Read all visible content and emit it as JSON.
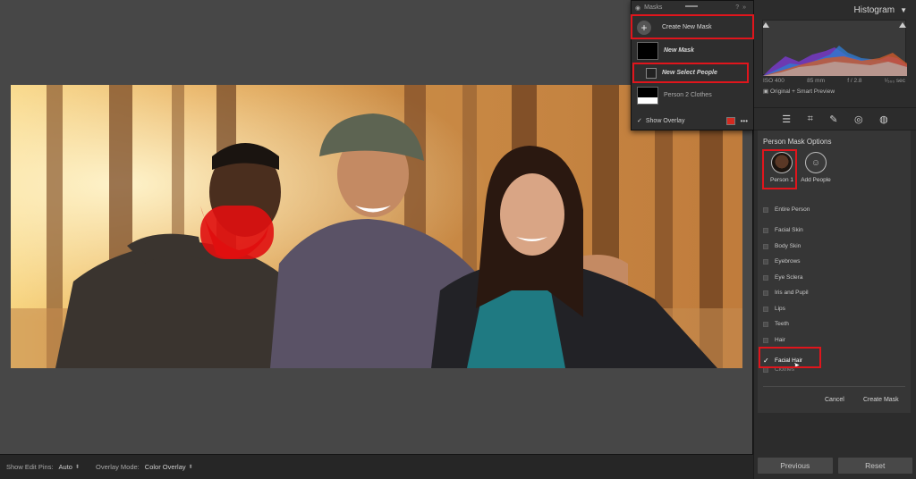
{
  "masks_panel": {
    "title": "Masks",
    "items": [
      {
        "label": "Create New Mask"
      },
      {
        "label": "New Mask"
      },
      {
        "label": "New Select People"
      },
      {
        "label": "Person 2 Clothes"
      }
    ],
    "show_overlay_label": "Show Overlay",
    "overlay_color": "#d42a20"
  },
  "histogram": {
    "title": "Histogram",
    "iso": "ISO 400",
    "focal": "85 mm",
    "aperture": "f / 2.8",
    "shutter": "¹⁄₅₀₀ sec",
    "source": "Original + Smart Preview"
  },
  "person_mask": {
    "title": "Person Mask Options",
    "person1": "Person 1",
    "add_people": "Add People",
    "options": [
      {
        "label": "Entire Person",
        "checked": false
      },
      {
        "label": "Facial Skin",
        "checked": false
      },
      {
        "label": "Body Skin",
        "checked": false
      },
      {
        "label": "Eyebrows",
        "checked": false
      },
      {
        "label": "Eye Sclera",
        "checked": false
      },
      {
        "label": "Iris and Pupil",
        "checked": false
      },
      {
        "label": "Lips",
        "checked": false
      },
      {
        "label": "Teeth",
        "checked": false
      },
      {
        "label": "Hair",
        "checked": false
      },
      {
        "label": "Facial Hair",
        "checked": true
      },
      {
        "label": "Clothes",
        "checked": false
      }
    ],
    "cancel": "Cancel",
    "create": "Create Mask"
  },
  "footer": {
    "previous": "Previous",
    "reset": "Reset"
  },
  "bottom_bar": {
    "edit_pins_label": "Show Edit Pins:",
    "edit_pins_value": "Auto",
    "overlay_mode_label": "Overlay Mode:",
    "overlay_mode_value": "Color Overlay"
  },
  "colors": {
    "highlight": "#e0151c",
    "mask_overlay": "#e01010"
  }
}
